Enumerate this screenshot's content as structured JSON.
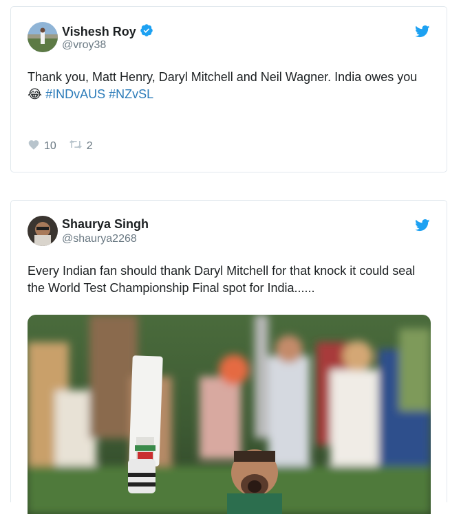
{
  "tweets": [
    {
      "author_name": "Vishesh Roy",
      "handle": "@vroy38",
      "verified": true,
      "text_plain": "Thank you, Matt Henry, Daryl Mitchell and Neil Wagner. India owes you",
      "emoji": "😂",
      "hashtags": [
        "#INDvAUS",
        "#NZvSL"
      ],
      "likes": "10",
      "retweets": "2"
    },
    {
      "author_name": "Shaurya Singh",
      "handle": "@shaurya2268",
      "verified": false,
      "text_plain": "Every Indian fan should thank Daryl Mitchell for that knock it could seal the World Test Championship Final spot for India......"
    }
  ],
  "colors": {
    "twitter_blue": "#1da1f2",
    "hashtag": "#2b7bb9",
    "muted": "#697882",
    "border": "#e1e8ed"
  },
  "icons": [
    "verified-badge-icon",
    "twitter-bird-icon",
    "heart-icon",
    "retweet-icon"
  ]
}
